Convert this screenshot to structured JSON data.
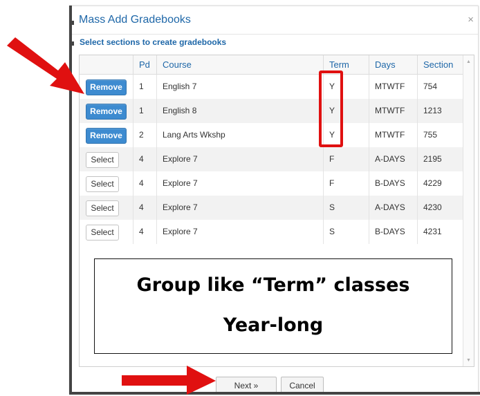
{
  "dialog": {
    "title": "Mass Add Gradebooks",
    "close_glyph": "×",
    "subtitle": "Select sections to create gradebooks"
  },
  "table": {
    "columns": [
      "",
      "Pd",
      "Course",
      "Term",
      "Days",
      "Section"
    ],
    "rows": [
      {
        "action": "Remove",
        "pd": "1",
        "course": "English 7",
        "term": "Y",
        "days": "MTWTF",
        "section": "754"
      },
      {
        "action": "Remove",
        "pd": "1",
        "course": "English 8",
        "term": "Y",
        "days": "MTWTF",
        "section": "1213"
      },
      {
        "action": "Remove",
        "pd": "2",
        "course": "Lang Arts Wkshp",
        "term": "Y",
        "days": "MTWTF",
        "section": "755"
      },
      {
        "action": "Select",
        "pd": "4",
        "course": "Explore 7",
        "term": "F",
        "days": "A-DAYS",
        "section": "2195"
      },
      {
        "action": "Select",
        "pd": "4",
        "course": "Explore 7",
        "term": "F",
        "days": "B-DAYS",
        "section": "4229"
      },
      {
        "action": "Select",
        "pd": "4",
        "course": "Explore 7",
        "term": "S",
        "days": "A-DAYS",
        "section": "4230"
      },
      {
        "action": "Select",
        "pd": "4",
        "course": "Explore 7",
        "term": "S",
        "days": "B-DAYS",
        "section": "4231"
      }
    ]
  },
  "callout": {
    "line1": "Group like “Term” classes",
    "line2": "Year-long"
  },
  "footer": {
    "next_label": "Next »",
    "cancel_label": "Cancel"
  },
  "colors": {
    "accent": "#1e67a8",
    "remove_button": "#3d8bd0",
    "annotation_red": "#e01010"
  },
  "icons": {
    "scroll_up": "▲",
    "scroll_down": "▼"
  }
}
